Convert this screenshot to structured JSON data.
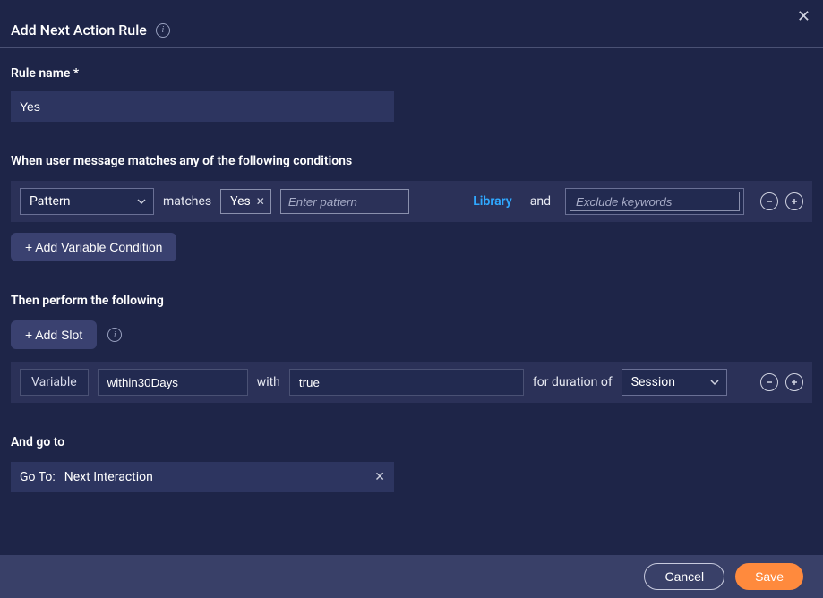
{
  "header": {
    "title": "Add Next Action Rule"
  },
  "rule_name": {
    "label": "Rule name *",
    "value": "Yes"
  },
  "conditions": {
    "label": "When user message matches any of the following conditions",
    "type_select": "Pattern",
    "matches_word": "matches",
    "chip": "Yes",
    "pattern_placeholder": "Enter pattern",
    "library_link": "Library",
    "and_word": "and",
    "exclude_placeholder": "Exclude keywords",
    "add_variable_condition": "+ Add Variable Condition"
  },
  "actions": {
    "label": "Then perform the following",
    "add_slot": "+ Add Slot",
    "variable_tag": "Variable",
    "variable_name": "within30Days",
    "with_word": "with",
    "value": "true",
    "duration_word": "for duration of",
    "duration_select": "Session"
  },
  "goto": {
    "label": "And go to",
    "prefix": "Go To:",
    "value": "Next Interaction"
  },
  "footer": {
    "cancel": "Cancel",
    "save": "Save"
  }
}
